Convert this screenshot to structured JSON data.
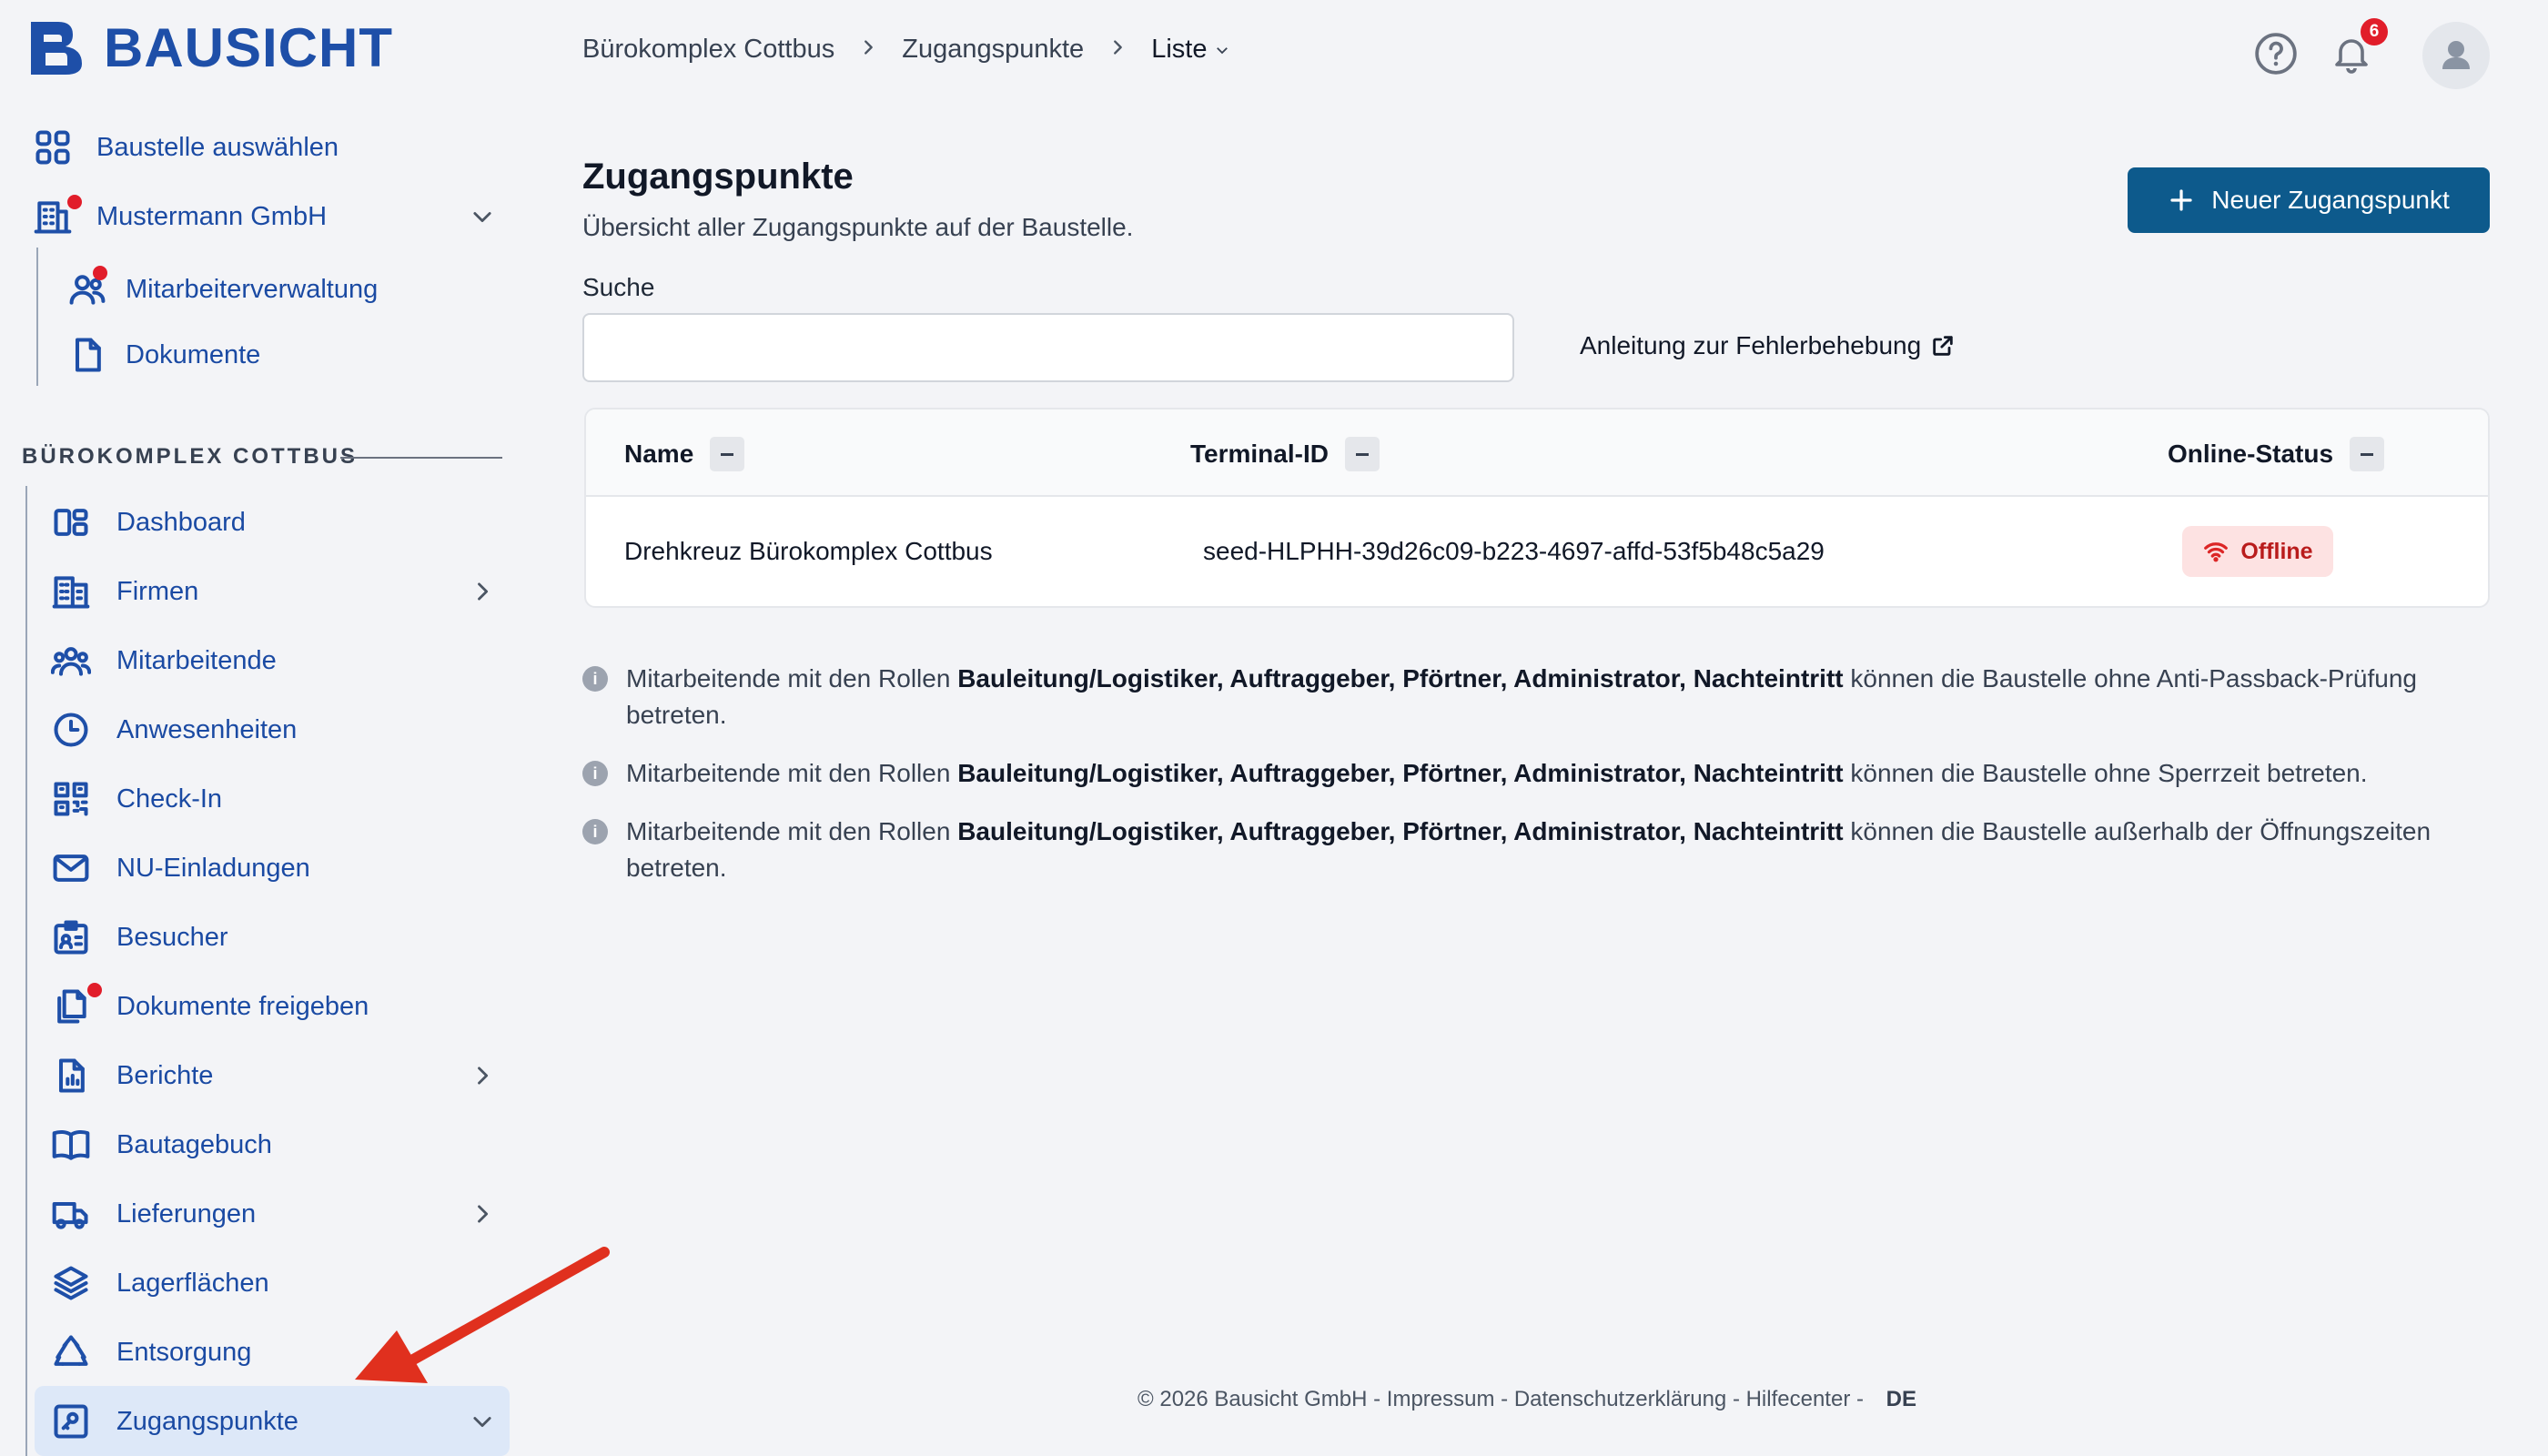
{
  "brand": {
    "name": "BAUSICHT",
    "accent": "#1e4fa8",
    "primary_button": "#0d5a8c"
  },
  "sidebar": {
    "select_site": "Baustelle auswählen",
    "company": "Mustermann GmbH",
    "company_sub": [
      "Mitarbeiterverwaltung",
      "Dokumente"
    ],
    "section_title": "BÜROKOMPLEX COTTBUS",
    "items": [
      {
        "label": "Dashboard",
        "icon": "dashboard-icon"
      },
      {
        "label": "Firmen",
        "icon": "building-icon"
      },
      {
        "label": "Mitarbeitende",
        "icon": "users-icon"
      },
      {
        "label": "Anwesenheiten",
        "icon": "clock-icon"
      },
      {
        "label": "Check-In",
        "icon": "qr-icon"
      },
      {
        "label": "NU-Einladungen",
        "icon": "mail-icon"
      },
      {
        "label": "Besucher",
        "icon": "id-card-icon"
      },
      {
        "label": "Dokumente freigeben",
        "icon": "documents-icon"
      },
      {
        "label": "Berichte",
        "icon": "report-icon"
      },
      {
        "label": "Bautagebuch",
        "icon": "book-icon"
      },
      {
        "label": "Lieferungen",
        "icon": "truck-icon"
      },
      {
        "label": "Lagerflächen",
        "icon": "layers-icon"
      },
      {
        "label": "Entsorgung",
        "icon": "recycle-icon"
      },
      {
        "label": "Zugangspunkte",
        "icon": "access-point-icon"
      }
    ]
  },
  "header": {
    "breadcrumb": [
      "Bürokomplex Cottbus",
      "Zugangspunkte",
      "Liste"
    ],
    "notification_count": "6"
  },
  "main": {
    "title": "Zugangspunkte",
    "subtitle": "Übersicht aller Zugangspunkte auf der Baustelle.",
    "new_button": "Neuer Zugangspunkt",
    "search_label": "Suche",
    "search_value": "",
    "help_link": "Anleitung zur Fehlerbehebung",
    "table": {
      "columns": [
        "Name",
        "Terminal-ID",
        "Online-Status"
      ],
      "rows": [
        {
          "name": "Drehkreuz Bürokomplex Cottbus",
          "terminal_id": "seed-HLPHH-39d26c09-b223-4697-affd-53f5b48c5a29",
          "status": "Offline"
        }
      ]
    },
    "notes": [
      {
        "prefix": "Mitarbeitende mit den Rollen ",
        "roles": "Bauleitung/Logistiker, Auftraggeber, Pförtner, Administrator, Nachteintritt",
        "suffix": " können die Baustelle ohne Anti-Passback-Prüfung betreten."
      },
      {
        "prefix": "Mitarbeitende mit den Rollen ",
        "roles": "Bauleitung/Logistiker, Auftraggeber, Pförtner, Administrator, Nachteintritt",
        "suffix": " können die Baustelle ohne Sperrzeit betreten."
      },
      {
        "prefix": "Mitarbeitende mit den Rollen ",
        "roles": "Bauleitung/Logistiker, Auftraggeber, Pförtner, Administrator, Nachteintritt",
        "suffix": " können die Baustelle außerhalb der Öffnungszeiten betreten."
      }
    ]
  },
  "footer": {
    "text": "© 2026 Bausicht GmbH - Impressum - Datenschutzerklärung - Hilfecenter -",
    "language": "DE"
  }
}
